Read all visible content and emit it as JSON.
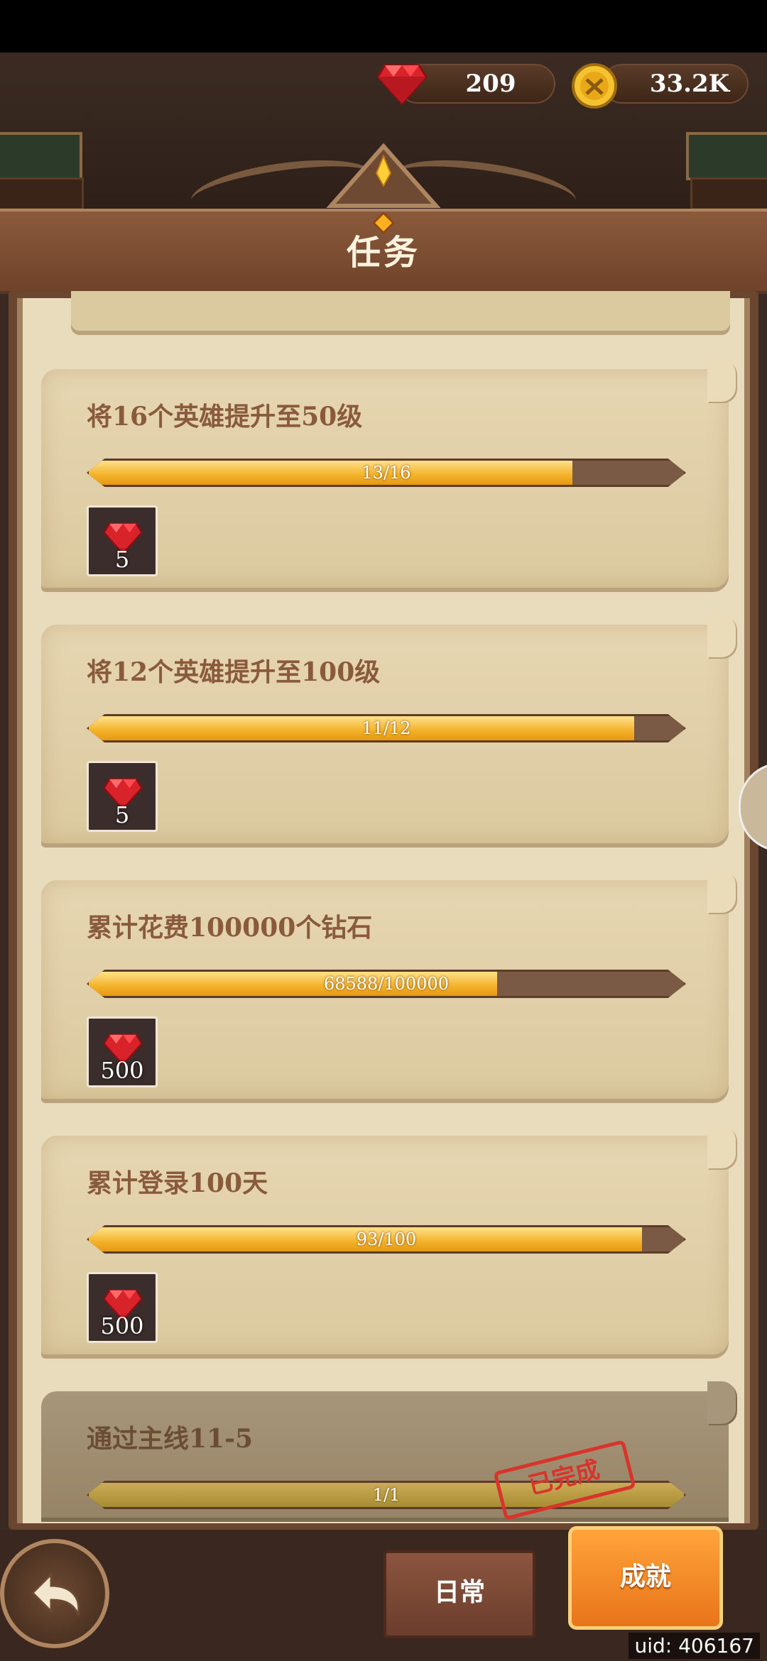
{
  "currency": {
    "gems": "209",
    "gold": "33.2K"
  },
  "header": {
    "title": "任务"
  },
  "tasks": [
    {
      "title": "将16个英雄提升至50级",
      "progress_text": "13/16",
      "progress": 0.8125,
      "reward_count": "5",
      "reward_icon": "gem-icon",
      "completed": false
    },
    {
      "title": "将12个英雄提升至100级",
      "progress_text": "11/12",
      "progress": 0.9167,
      "reward_count": "5",
      "reward_icon": "gem-icon",
      "completed": false
    },
    {
      "title": "累计花费100000个钻石",
      "progress_text": "68588/100000",
      "progress": 0.68588,
      "reward_count": "500",
      "reward_icon": "gem-icon",
      "completed": false
    },
    {
      "title": "累计登录100天",
      "progress_text": "93/100",
      "progress": 0.93,
      "reward_count": "500",
      "reward_icon": "gem-icon",
      "completed": false
    },
    {
      "title": "通过主线11-5",
      "progress_text": "1/1",
      "progress": 1.0,
      "stamp": "已完成",
      "completed": true
    }
  ],
  "tabs": {
    "daily": "日常",
    "achievement": "成就"
  },
  "uid": "uid: 406167",
  "colors": {
    "progress_fill": "#f3b22a",
    "active_tab": "#e8741a",
    "stamp": "#d9342b"
  }
}
